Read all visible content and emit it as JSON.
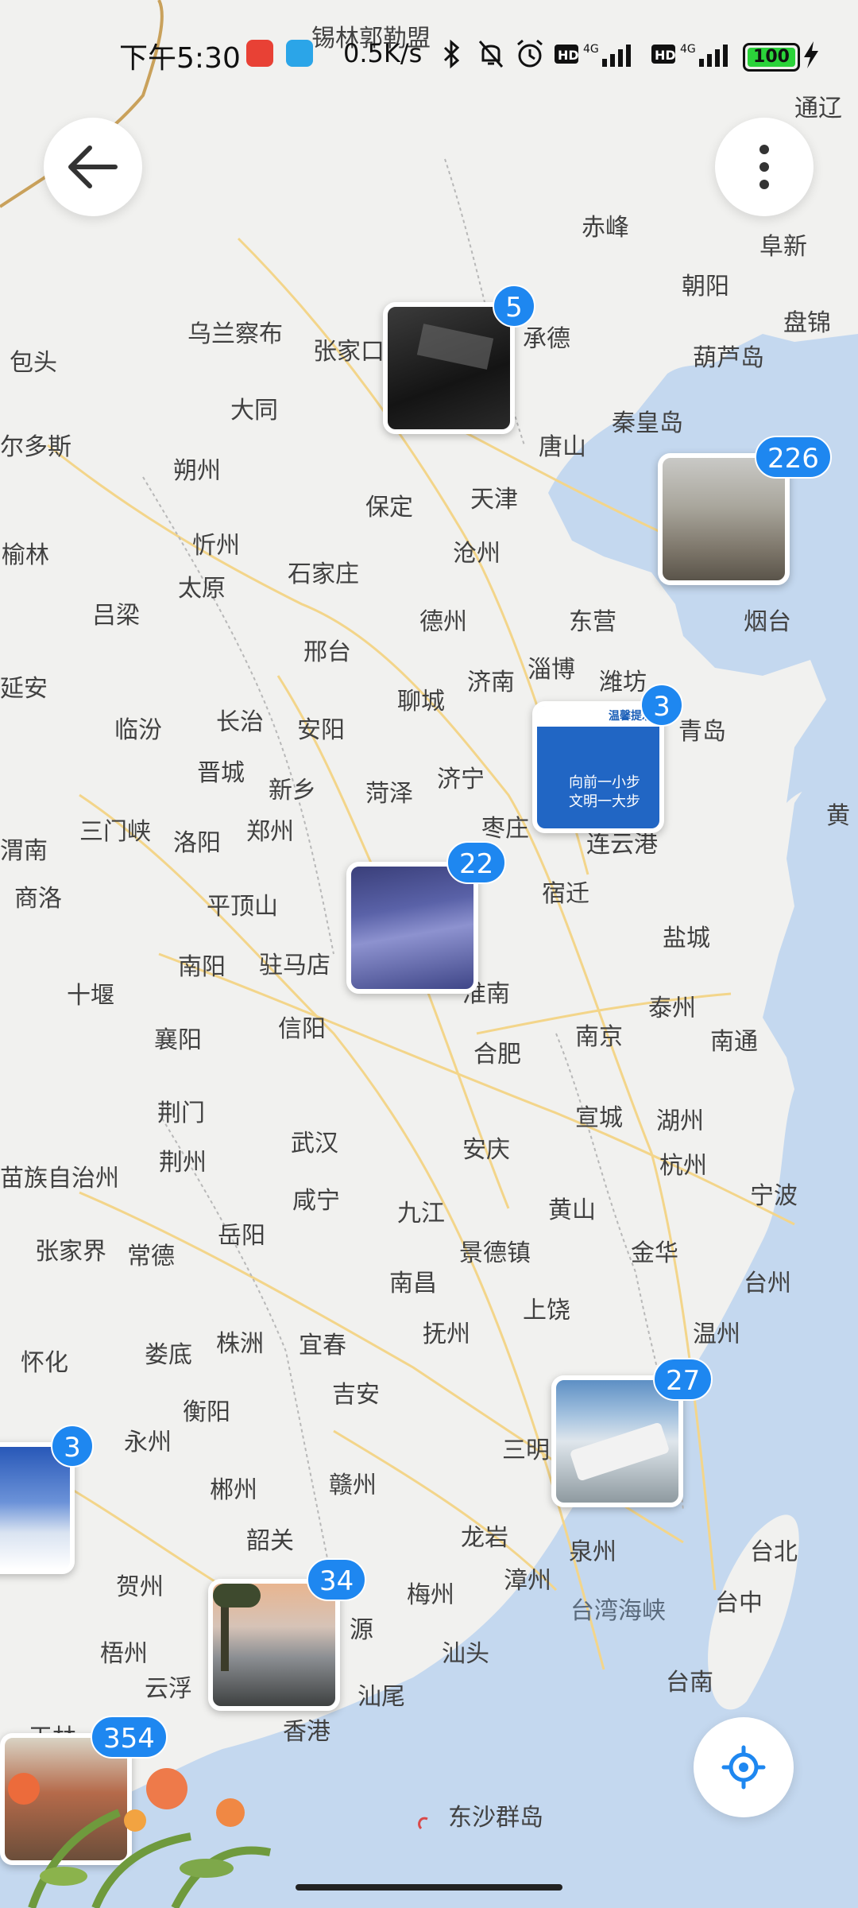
{
  "status_bar": {
    "time": "下午5:30",
    "speed": "0.5K/s",
    "battery": "100"
  },
  "buttons": {
    "back_icon": "arrow-left",
    "more_icon": "vertical-ellipsis",
    "locate_icon": "crosshair"
  },
  "map": {
    "labels": [
      "锡林郭勒盟",
      "通辽",
      "赤峰",
      "阜新",
      "朝阳",
      "盘锦",
      "葫芦岛",
      "秦皇岛",
      "承德",
      "唐山",
      "乌兰察布",
      "张家口",
      "包头",
      "大同",
      "尔多斯",
      "朔州",
      "保定",
      "天津",
      "忻州",
      "沧州",
      "榆林",
      "太原",
      "石家庄",
      "德州",
      "东营",
      "烟台",
      "吕梁",
      "邢台",
      "济南",
      "淄博",
      "潍坊",
      "青岛",
      "延安",
      "临汾",
      "长治",
      "安阳",
      "聊城",
      "晋城",
      "新乡",
      "菏泽",
      "济宁",
      "枣庄",
      "连云港",
      "三门峡",
      "洛阳",
      "郑州",
      "商洛",
      "渭南",
      "平顶山",
      "宿迁",
      "盐城",
      "南阳",
      "驻马店",
      "淮南",
      "十堰",
      "襄阳",
      "信阳",
      "合肥",
      "南京",
      "泰州",
      "南通",
      "荆门",
      "宣城",
      "湖州",
      "荆州",
      "武汉",
      "安庆",
      "杭州",
      "宁波",
      "咸宁",
      "九江",
      "黄山",
      "苗族自治州",
      "张家界",
      "常德",
      "岳阳",
      "景德镇",
      "金华",
      "台州",
      "南昌",
      "上饶",
      "怀化",
      "娄底",
      "株洲",
      "宜春",
      "抚州",
      "温州",
      "衡阳",
      "吉安",
      "永州",
      "三明",
      "郴州",
      "赣州",
      "龙岩",
      "泉州",
      "台北",
      "韶关",
      "漳州",
      "梅州",
      "台湾海峡",
      "台中",
      "贺州",
      "梧州",
      "源",
      "汕头",
      "云浮",
      "汕尾",
      "台南",
      "玉林",
      "香港",
      "东沙群岛",
      "黄"
    ]
  },
  "clusters": [
    {
      "count": "5"
    },
    {
      "count": "226"
    },
    {
      "count": "3"
    },
    {
      "count": "22"
    },
    {
      "count": "27"
    },
    {
      "count": "3"
    },
    {
      "count": "34"
    },
    {
      "count": "354"
    }
  ],
  "sign_text": {
    "header": "温馨提示",
    "line1": "向前一小步",
    "line2": "文明一大步"
  },
  "colors": {
    "land": "#f1f1ef",
    "sea": "#c4d8ef",
    "road": "#f3d58a",
    "badge": "#1e87f0"
  }
}
